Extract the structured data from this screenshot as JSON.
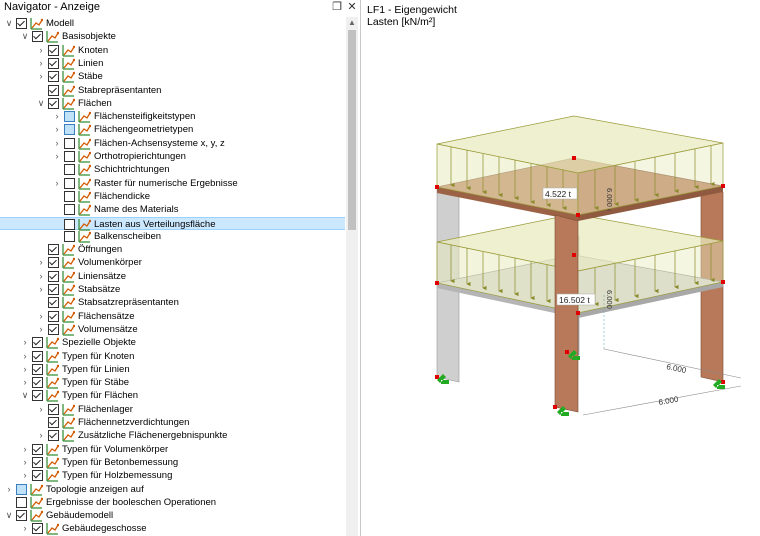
{
  "navigator": {
    "title": "Navigator - Anzeige",
    "pin_icon": "pin-icon",
    "close_icon": "close-icon",
    "items": [
      {
        "label": "Modell",
        "level": 0,
        "expander": "open",
        "check": "checked"
      },
      {
        "label": "Basisobjekte",
        "level": 1,
        "expander": "open",
        "check": "checked"
      },
      {
        "label": "Knoten",
        "level": 2,
        "expander": "closed",
        "check": "checked"
      },
      {
        "label": "Linien",
        "level": 2,
        "expander": "closed",
        "check": "checked"
      },
      {
        "label": "Stäbe",
        "level": 2,
        "expander": "closed",
        "check": "checked"
      },
      {
        "label": "Stabrepräsentanten",
        "level": 2,
        "expander": "none",
        "check": "checked"
      },
      {
        "label": "Flächen",
        "level": 2,
        "expander": "open",
        "check": "checked"
      },
      {
        "label": "Flächensteifigkeitstypen",
        "level": 3,
        "expander": "closed",
        "check": "partial"
      },
      {
        "label": "Flächengeometrietypen",
        "level": 3,
        "expander": "closed",
        "check": "partial"
      },
      {
        "label": "Flächen-Achsensysteme x, y, z",
        "level": 3,
        "expander": "closed",
        "check": "unchecked"
      },
      {
        "label": "Orthotropierichtungen",
        "level": 3,
        "expander": "closed",
        "check": "unchecked"
      },
      {
        "label": "Schichtrichtungen",
        "level": 3,
        "expander": "none",
        "check": "unchecked"
      },
      {
        "label": "Raster für numerische Ergebnisse",
        "level": 3,
        "expander": "closed",
        "check": "unchecked"
      },
      {
        "label": "Flächendicke",
        "level": 3,
        "expander": "none",
        "check": "unchecked"
      },
      {
        "label": "Name des Materials",
        "level": 3,
        "expander": "none",
        "check": "unchecked"
      },
      {
        "label": "Lasten aus Verteilungsfläche",
        "level": 3,
        "expander": "none",
        "check": "unchecked",
        "selected": true
      },
      {
        "label": "Balkenscheiben",
        "level": 3,
        "expander": "none",
        "check": "unchecked"
      },
      {
        "label": "Öffnungen",
        "level": 2,
        "expander": "none",
        "check": "checked"
      },
      {
        "label": "Volumenkörper",
        "level": 2,
        "expander": "closed",
        "check": "checked"
      },
      {
        "label": "Liniensätze",
        "level": 2,
        "expander": "closed",
        "check": "checked"
      },
      {
        "label": "Stabsätze",
        "level": 2,
        "expander": "closed",
        "check": "checked"
      },
      {
        "label": "Stabsatzrepräsentanten",
        "level": 2,
        "expander": "none",
        "check": "checked"
      },
      {
        "label": "Flächensätze",
        "level": 2,
        "expander": "closed",
        "check": "checked"
      },
      {
        "label": "Volumensätze",
        "level": 2,
        "expander": "closed",
        "check": "checked"
      },
      {
        "label": "Spezielle Objekte",
        "level": 1,
        "expander": "closed",
        "check": "checked"
      },
      {
        "label": "Typen für Knoten",
        "level": 1,
        "expander": "closed",
        "check": "checked"
      },
      {
        "label": "Typen für Linien",
        "level": 1,
        "expander": "closed",
        "check": "checked"
      },
      {
        "label": "Typen für Stäbe",
        "level": 1,
        "expander": "closed",
        "check": "checked"
      },
      {
        "label": "Typen für Flächen",
        "level": 1,
        "expander": "open",
        "check": "checked"
      },
      {
        "label": "Flächenlager",
        "level": 2,
        "expander": "closed",
        "check": "checked"
      },
      {
        "label": "Flächennetzverdichtungen",
        "level": 2,
        "expander": "none",
        "check": "checked"
      },
      {
        "label": "Zusätzliche Flächenergebnispunkte",
        "level": 2,
        "expander": "closed",
        "check": "checked"
      },
      {
        "label": "Typen für Volumenkörper",
        "level": 1,
        "expander": "closed",
        "check": "checked"
      },
      {
        "label": "Typen für Betonbemessung",
        "level": 1,
        "expander": "closed",
        "check": "checked"
      },
      {
        "label": "Typen für Holzbemessung",
        "level": 1,
        "expander": "closed",
        "check": "checked"
      },
      {
        "label": "Topologie anzeigen auf",
        "level": 0,
        "expander": "closed",
        "check": "partial"
      },
      {
        "label": "Ergebnisse der booleschen Operationen",
        "level": 0,
        "expander": "none",
        "check": "unchecked"
      },
      {
        "label": "Gebäudemodell",
        "level": 0,
        "expander": "open",
        "check": "checked"
      },
      {
        "label": "Gebäudegeschosse",
        "level": 1,
        "expander": "closed",
        "check": "checked"
      }
    ]
  },
  "view": {
    "load_case": "LF1 - Eigengewicht",
    "units_label": "Lasten [kN/m²]",
    "annotations": {
      "top_load": "4.522 t",
      "bottom_load": "16.502 t",
      "dim_right": "6.000",
      "dim_front": "6.000",
      "pressure_top": "6.000 ‹",
      "pressure_bottom": "6.000"
    }
  },
  "colors": {
    "load_fill": "#e9ebbf",
    "load_stroke": "#9a9b3a",
    "wood": "#b8795a",
    "concrete": "#c8c8c8",
    "support": "#22aa22",
    "node": "#e00000",
    "selection": "#cce8ff"
  }
}
